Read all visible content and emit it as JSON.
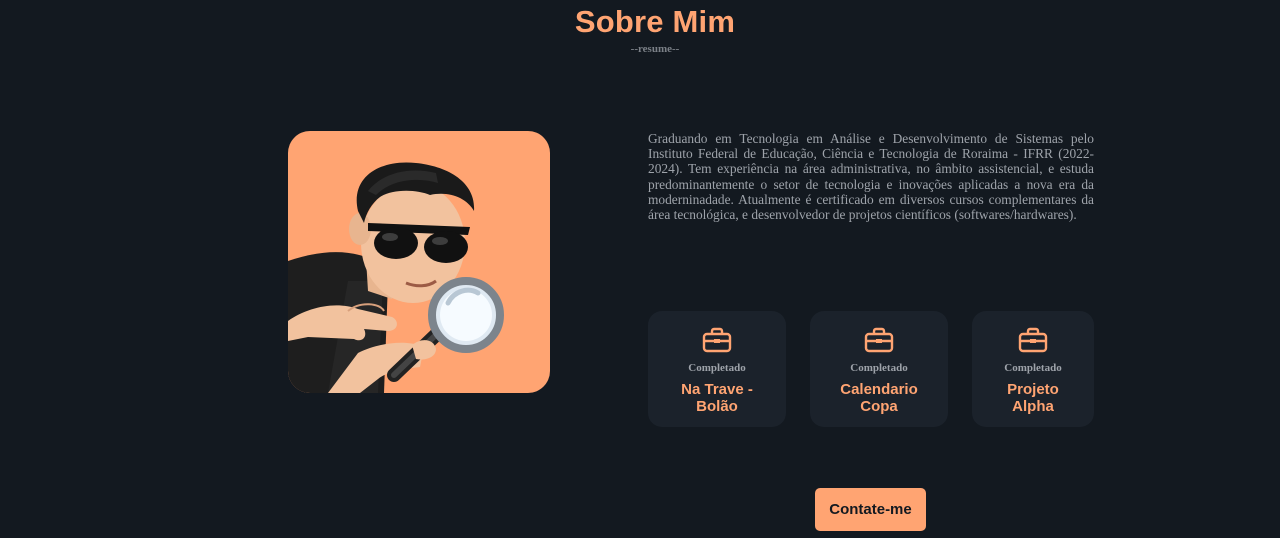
{
  "section": {
    "title": "Sobre Mim",
    "subtitle": "--resume--"
  },
  "about": {
    "bio": "Graduando em Tecnologia em Análise e Desenvolvimento de Sistemas pelo Instituto Federal de Educação, Ciência e Tecnologia de Roraima - IFRR (2022-2024). Tem experiência na área administrativa, no âmbito assistencial, e estuda predominantemente o setor de tecnologia e inovações aplicadas a nova era da moderninadade. Atualmente é certificado em diversos cursos complementares da área tecnológica, e desenvolvedor de projetos científicos (softwares/hardwares)."
  },
  "projects": [
    {
      "icon": "briefcase-icon",
      "status": "Completado",
      "name_line1": "Na Trave -",
      "name_line2": "Bolão"
    },
    {
      "icon": "briefcase-icon",
      "status": "Completado",
      "name_line1": "Calendario",
      "name_line2": "Copa"
    },
    {
      "icon": "briefcase-icon",
      "status": "Completado",
      "name_line1": "Projeto",
      "name_line2": "Alpha"
    }
  ],
  "contact": {
    "label": "Contate-me"
  },
  "colors": {
    "background": "#131920",
    "card": "#1b222b",
    "accent": "#ffa472",
    "text_muted": "#9ea3aa"
  }
}
